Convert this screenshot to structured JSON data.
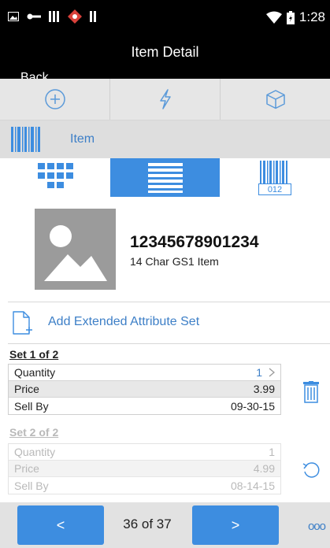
{
  "status_bar": {
    "icons": [
      "image-icon",
      "key-icon",
      "bars-icon",
      "alert-diamond-icon",
      "bars-icon",
      "wifi-icon",
      "battery-icon"
    ],
    "time": "1:28"
  },
  "nav": {
    "back_label": "Back",
    "title": "Item Detail"
  },
  "toolbar": {
    "icons": [
      "plus-circle-icon",
      "lightning-icon",
      "cube-icon"
    ]
  },
  "item_header": {
    "label": "Item",
    "icon": "barcode-icon"
  },
  "view_tabs": {
    "icons": [
      "grid-view-icon",
      "list-view-icon",
      "barcode-view-icon"
    ],
    "active_index": 1,
    "barcode_tab_text": "012"
  },
  "item": {
    "number": "12345678901234",
    "description": "14 Char GS1 Item",
    "thumbnail_icon": "image-placeholder-icon"
  },
  "add_extended": {
    "label": "Add Extended Attribute Set",
    "icon": "add-document-icon"
  },
  "sets": [
    {
      "title": "Set 1 of 2",
      "rows": [
        {
          "label": "Quantity",
          "value": "1"
        },
        {
          "label": "Price",
          "value": "3.99"
        },
        {
          "label": "Sell By",
          "value": "09-30-15"
        }
      ],
      "action_icon": "trash-icon"
    },
    {
      "title": "Set 2 of 2",
      "rows": [
        {
          "label": "Quantity",
          "value": "1"
        },
        {
          "label": "Price",
          "value": "4.99"
        },
        {
          "label": "Sell By",
          "value": "08-14-15"
        }
      ],
      "action_icon": "undo-icon"
    }
  ],
  "footer": {
    "prev_label": "<",
    "pager": "36 of 37",
    "next_label": ">",
    "more_label": "ooo"
  },
  "colors": {
    "accent": "#3d8de0",
    "link": "#3d7fc7",
    "bar": "#000000"
  }
}
